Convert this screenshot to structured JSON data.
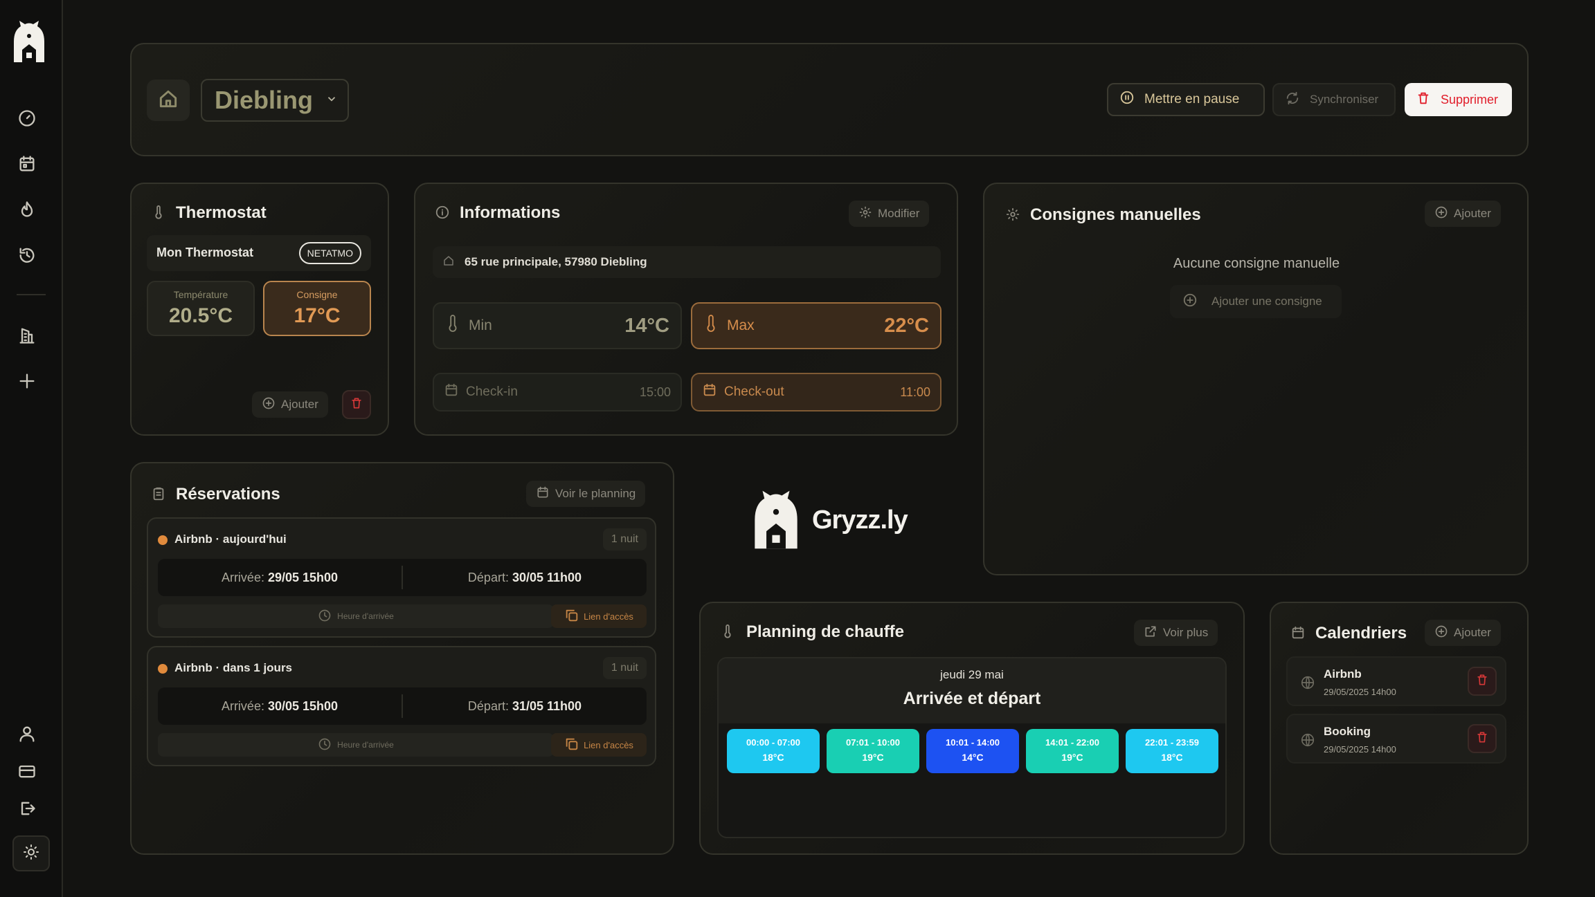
{
  "sidebar": {
    "logo": "bear-house-logo",
    "items": [
      {
        "icon": "gauge-icon"
      },
      {
        "icon": "calendar-icon"
      },
      {
        "icon": "flame-icon"
      },
      {
        "icon": "history-icon"
      },
      {
        "icon": "building-icon"
      },
      {
        "icon": "plus-icon"
      }
    ],
    "bottom_items": [
      {
        "icon": "user-icon"
      },
      {
        "icon": "credit-card-icon"
      },
      {
        "icon": "logout-icon"
      }
    ],
    "theme_icon": "sun-icon"
  },
  "header": {
    "property_name": "Diebling",
    "pause_label": "Mettre en pause",
    "sync_label": "Synchroniser",
    "delete_label": "Supprimer"
  },
  "thermostat": {
    "title": "Thermostat",
    "device_name": "Mon Thermostat",
    "brand_badge": "NETATMO",
    "temperature_label": "Température",
    "temperature_value": "20.5°C",
    "consigne_label": "Consigne",
    "consigne_value": "17°C",
    "add_label": "Ajouter"
  },
  "informations": {
    "title": "Informations",
    "edit_label": "Modifier",
    "address": "65 rue principale, 57980 Diebling",
    "min_label": "Min",
    "min_value": "14°C",
    "max_label": "Max",
    "max_value": "22°C",
    "checkin_label": "Check-in",
    "checkin_time": "15:00",
    "checkout_label": "Check-out",
    "checkout_time": "11:00"
  },
  "consignes": {
    "title": "Consignes manuelles",
    "add_label": "Ajouter",
    "empty_text": "Aucune consigne manuelle",
    "add_consigne_label": "Ajouter une consigne"
  },
  "reservations": {
    "title": "Réservations",
    "planning_label": "Voir le planning",
    "items": [
      {
        "title": "Airbnb · aujourd'hui",
        "nights": "1 nuit",
        "arrival_label": "Arrivée:",
        "arrival": "29/05 15h00",
        "departure_label": "Départ:",
        "departure": "30/05 11h00",
        "arrival_time_label": "Heure d'arrivée",
        "access_label": "Lien d'accès"
      },
      {
        "title": "Airbnb · dans 1 jours",
        "nights": "1 nuit",
        "arrival_label": "Arrivée:",
        "arrival": "30/05 15h00",
        "departure_label": "Départ:",
        "departure": "31/05 11h00",
        "arrival_time_label": "Heure d'arrivée",
        "access_label": "Lien d'accès"
      }
    ]
  },
  "brand": {
    "name": "Gryzz.ly"
  },
  "planning": {
    "title": "Planning de chauffe",
    "more_label": "Voir plus",
    "date": "jeudi 29 mai",
    "event": "Arrivée et départ",
    "slots": [
      {
        "range": "00:00 - 07:00",
        "temp": "18°C",
        "color": "#1ec8f0"
      },
      {
        "range": "07:01 - 10:00",
        "temp": "19°C",
        "color": "#19cfb3"
      },
      {
        "range": "10:01 - 14:00",
        "temp": "14°C",
        "color": "#1d52f2"
      },
      {
        "range": "14:01 - 22:00",
        "temp": "19°C",
        "color": "#19cfb3"
      },
      {
        "range": "22:01 - 23:59",
        "temp": "18°C",
        "color": "#1ec8f0"
      }
    ]
  },
  "calendriers": {
    "title": "Calendriers",
    "add_label": "Ajouter",
    "items": [
      {
        "name": "Airbnb",
        "date": "29/05/2025 14h00"
      },
      {
        "name": "Booking",
        "date": "29/05/2025 14h00"
      }
    ]
  },
  "colors": {
    "accent_orange": "#e08a3c",
    "danger_red": "#e11d2a",
    "background": "#131311"
  }
}
